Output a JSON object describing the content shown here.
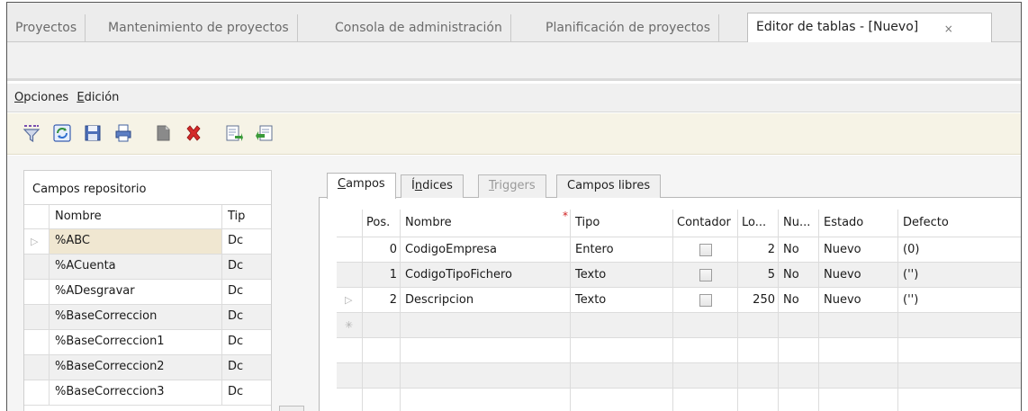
{
  "tabs": [
    {
      "label": "Proyectos",
      "active": false
    },
    {
      "label": "Mantenimiento de proyectos",
      "active": false
    },
    {
      "label": "Consola de administración",
      "active": false
    },
    {
      "label": "Planificación de proyectos",
      "active": false
    },
    {
      "label": "Editor de tablas - [Nuevo]",
      "active": true
    }
  ],
  "tab_close": "×",
  "menu": {
    "opciones": {
      "u": "O",
      "rest": "pciones"
    },
    "edicion": {
      "u": "E",
      "rest": "dición"
    }
  },
  "toolbar_icons": [
    "filter-icon",
    "refresh-icon",
    "save-icon",
    "print-icon",
    "new-document-icon",
    "delete-icon",
    "export-icon",
    "import-icon"
  ],
  "left_panel": {
    "title": "Campos repositorio",
    "headers": {
      "name": "Nombre",
      "type": "Tip"
    },
    "rows": [
      {
        "name": "%ABC",
        "type": "Dc"
      },
      {
        "name": "%ACuenta",
        "type": "Dc"
      },
      {
        "name": "%ADesgravar",
        "type": "Dc"
      },
      {
        "name": "%BaseCorreccion",
        "type": "Dc"
      },
      {
        "name": "%BaseCorreccion1",
        "type": "Dc"
      },
      {
        "name": "%BaseCorreccion2",
        "type": "Dc"
      },
      {
        "name": "%BaseCorreccion3",
        "type": "Dc"
      }
    ]
  },
  "right_tabs": {
    "campos": {
      "u": "C",
      "rest": "ampos"
    },
    "indices": {
      "pre": "Í",
      "u": "n",
      "rest": "dices"
    },
    "triggers": {
      "u": "T",
      "rest": "riggers"
    },
    "libres": "Campos libres"
  },
  "grid": {
    "headers": {
      "pos": "Pos.",
      "nombre": "Nombre",
      "required_mark": "*",
      "tipo": "Tipo",
      "contador": "Contador",
      "longitud": "Lo...",
      "nulo": "Nu...",
      "estado": "Estado",
      "defecto": "Defecto"
    },
    "new_row_marker": "✳",
    "rows": [
      {
        "pos": "0",
        "nombre": "CodigoEmpresa",
        "tipo": "Entero",
        "longitud": "2",
        "nulo": "No",
        "estado": "Nuevo",
        "defecto": "(0)"
      },
      {
        "pos": "1",
        "nombre": "CodigoTipoFichero",
        "tipo": "Texto",
        "longitud": "5",
        "nulo": "No",
        "estado": "Nuevo",
        "defecto": "('')"
      },
      {
        "pos": "2",
        "nombre": "Descripcion",
        "tipo": "Texto",
        "longitud": "250",
        "nulo": "No",
        "estado": "Nuevo",
        "defecto": "('')"
      }
    ]
  },
  "colors": {
    "toolbar_bg": "#f6f3e6",
    "selected_cell": "#f0e7d1",
    "required_star": "#d02020"
  }
}
